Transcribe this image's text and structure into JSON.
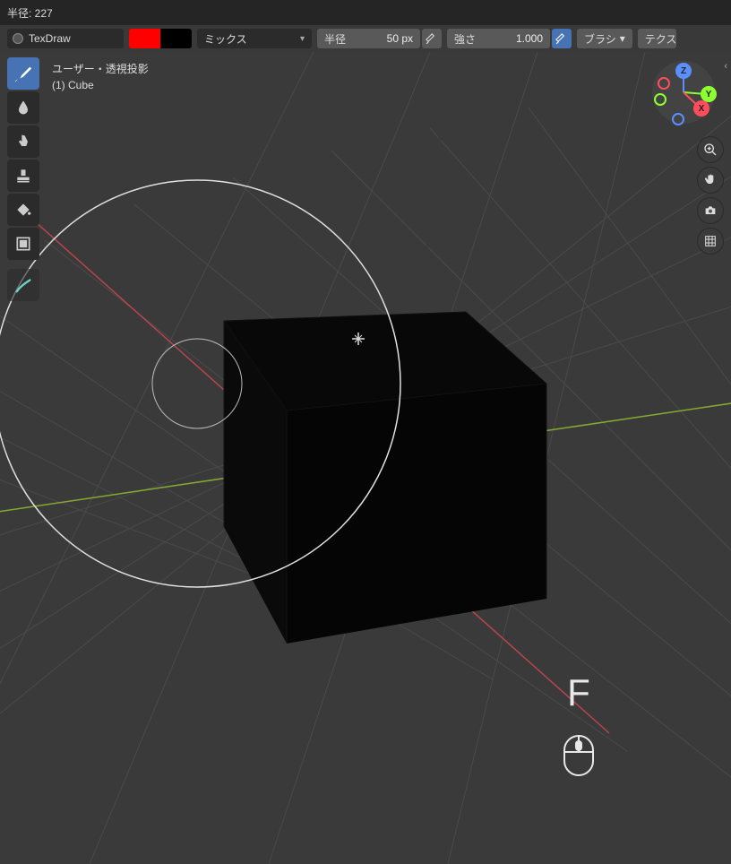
{
  "status": {
    "radius_label": "半径: 227"
  },
  "header": {
    "brush_name": "TexDraw",
    "primary_color": "#ff0000",
    "secondary_color": "#000000",
    "blend_mode": "ミックス",
    "radius_label": "半径",
    "radius_value": "50 px",
    "strength_label": "強さ",
    "strength_value": "1.000",
    "brush_dropdown": "ブラシ",
    "tex_dropdown": "テクス"
  },
  "viewport": {
    "projection": "ユーザー・透視投影",
    "object_label": "(1) Cube"
  },
  "axes": {
    "x": "X",
    "y": "Y",
    "z": "Z"
  },
  "tools": {
    "draw": "draw-tool",
    "soften": "soften-tool",
    "smear": "smear-tool",
    "clone": "clone-tool",
    "fill": "fill-tool",
    "mask": "mask-tool",
    "annotate": "annotate-tool"
  },
  "nav": {
    "zoom": "zoom-button",
    "pan": "pan-button",
    "camera": "camera-button",
    "persp": "perspective-button"
  },
  "indicator": {
    "key": "F"
  }
}
